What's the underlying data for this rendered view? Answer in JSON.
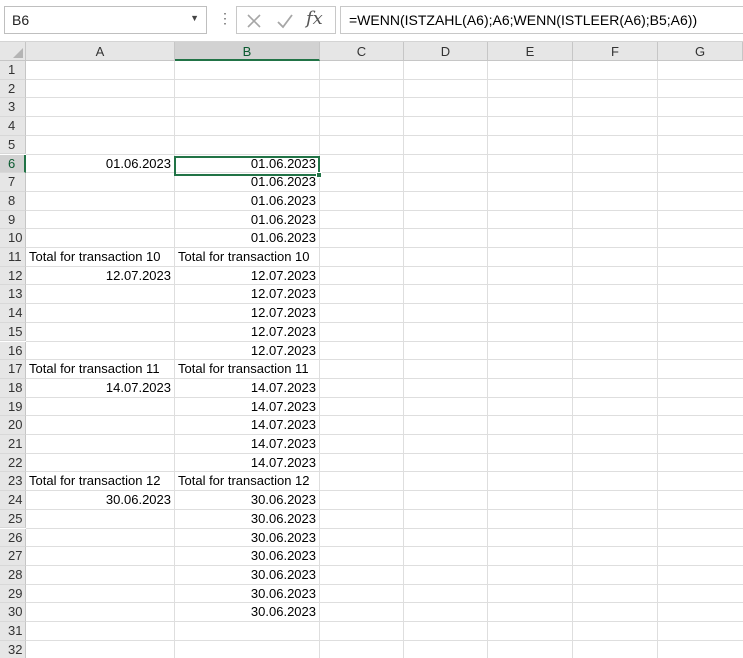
{
  "name_box": {
    "value": "B6"
  },
  "formula_bar": {
    "fx_label": "fx",
    "formula": "=WENN(ISTZAHL(A6);A6;WENN(ISTLEER(A6);B5;A6))"
  },
  "active_cell": "B6",
  "columns": [
    "A",
    "B",
    "C",
    "D",
    "E",
    "F",
    "G"
  ],
  "rows": [
    "1",
    "2",
    "3",
    "4",
    "5",
    "6",
    "7",
    "8",
    "9",
    "10",
    "11",
    "12",
    "13",
    "14",
    "15",
    "16",
    "17",
    "18",
    "19",
    "20",
    "21",
    "22",
    "23",
    "24",
    "25",
    "26",
    "27",
    "28",
    "29",
    "30",
    "31",
    "32"
  ],
  "cells": {
    "A6": "01.06.2023",
    "B6": "01.06.2023",
    "B7": "01.06.2023",
    "B8": "01.06.2023",
    "B9": "01.06.2023",
    "B10": "01.06.2023",
    "A11": "Total for transaction 10",
    "B11": "Total for transaction 10",
    "A12": "12.07.2023",
    "B12": "12.07.2023",
    "B13": "12.07.2023",
    "B14": "12.07.2023",
    "B15": "12.07.2023",
    "B16": "12.07.2023",
    "A17": "Total for transaction 11",
    "B17": "Total for transaction 11",
    "A18": "14.07.2023",
    "B18": "14.07.2023",
    "B19": "14.07.2023",
    "B20": "14.07.2023",
    "B21": "14.07.2023",
    "B22": "14.07.2023",
    "A23": "Total for transaction 12",
    "B23": "Total for transaction 12",
    "A24": "30.06.2023",
    "B24": "30.06.2023",
    "B25": "30.06.2023",
    "B26": "30.06.2023",
    "B27": "30.06.2023",
    "B28": "30.06.2023",
    "B29": "30.06.2023",
    "B30": "30.06.2023"
  },
  "left_aligned": [
    "A11",
    "B11",
    "A17",
    "B17",
    "A23",
    "B23"
  ],
  "colors": {
    "accent": "#217346",
    "header_bg": "#e6e6e6",
    "header_selected_bg": "#d2d2d2",
    "gridline": "#dedede"
  }
}
